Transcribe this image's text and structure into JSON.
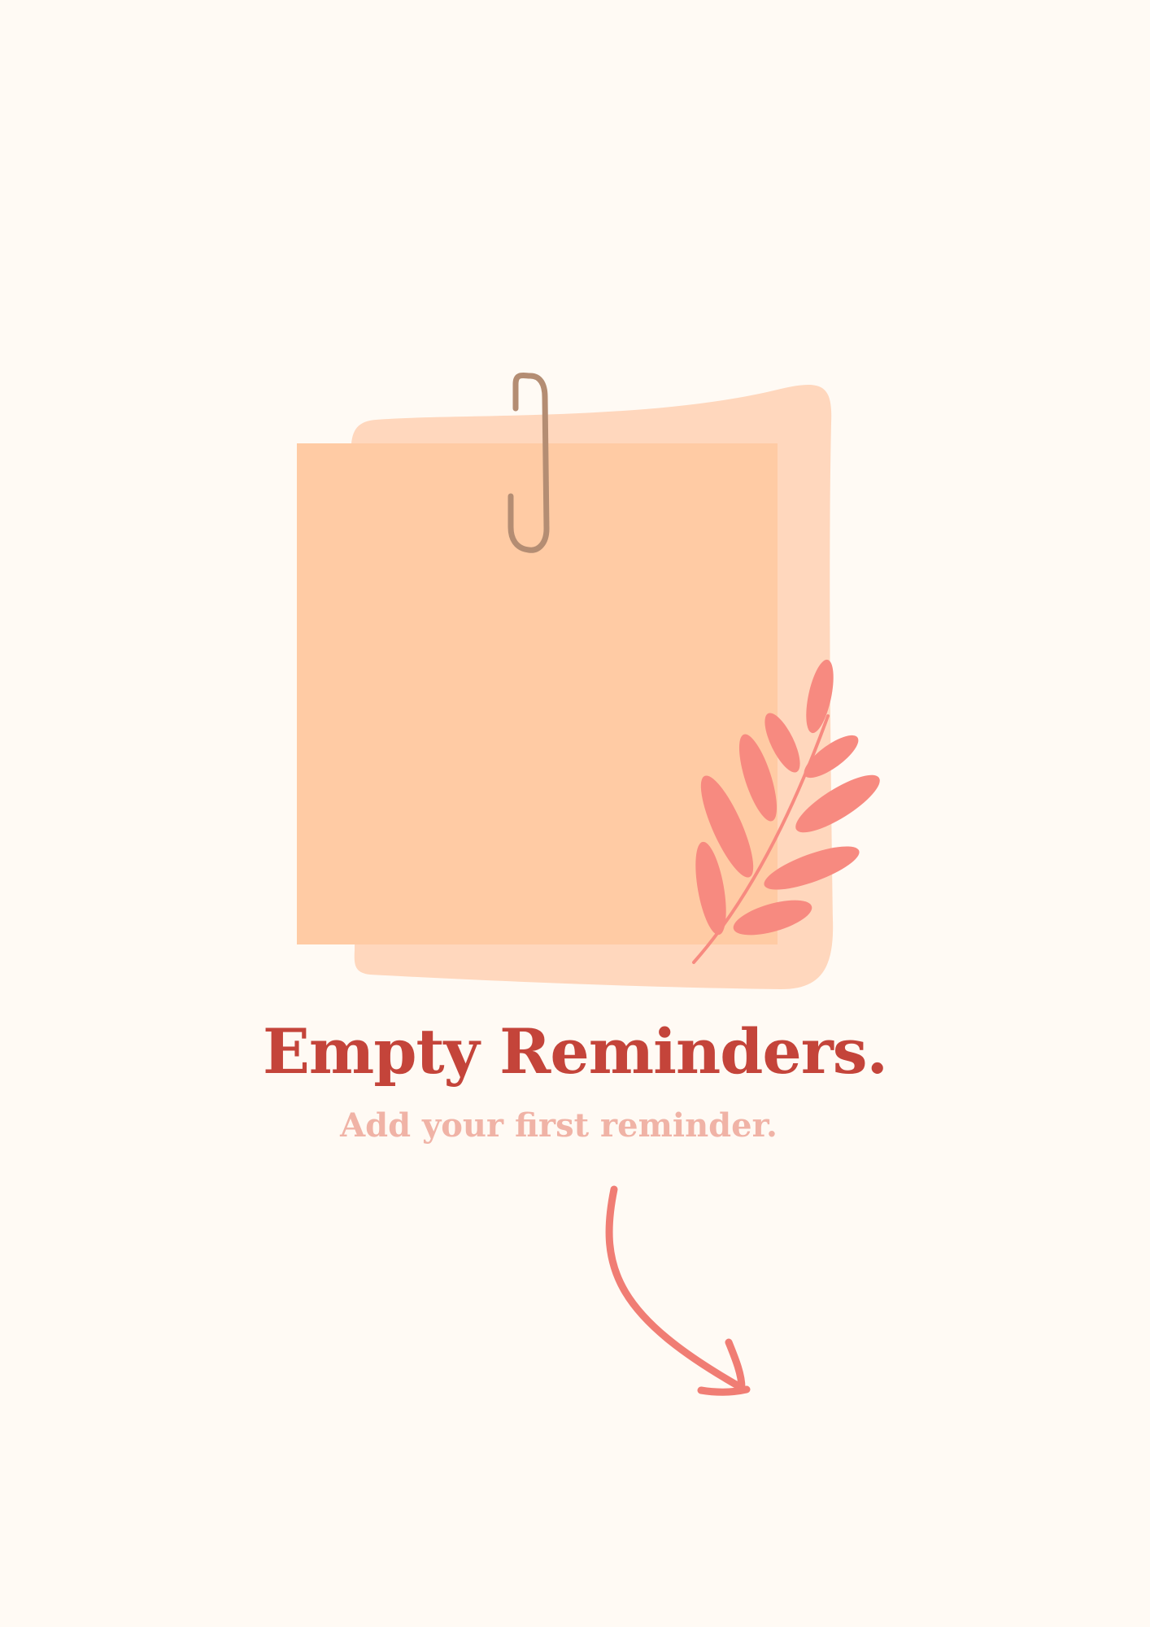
{
  "empty_state": {
    "title": "Empty Reminders.",
    "subtitle": "Add your first reminder.",
    "title_color": "#c4443a",
    "subtitle_color": "#f0b3a6"
  },
  "illustration": {
    "icons": [
      "sticky-note-icon",
      "paper-clip-icon",
      "leaf-sprig-icon",
      "curved-arrow-icon"
    ],
    "colors": {
      "background": "#fffaf4",
      "note_back": "#ffd7bd",
      "note_front": "#ffcba4",
      "clip": "#b48d73",
      "leaf": "#f78a80",
      "arrow": "#f07d74"
    }
  }
}
